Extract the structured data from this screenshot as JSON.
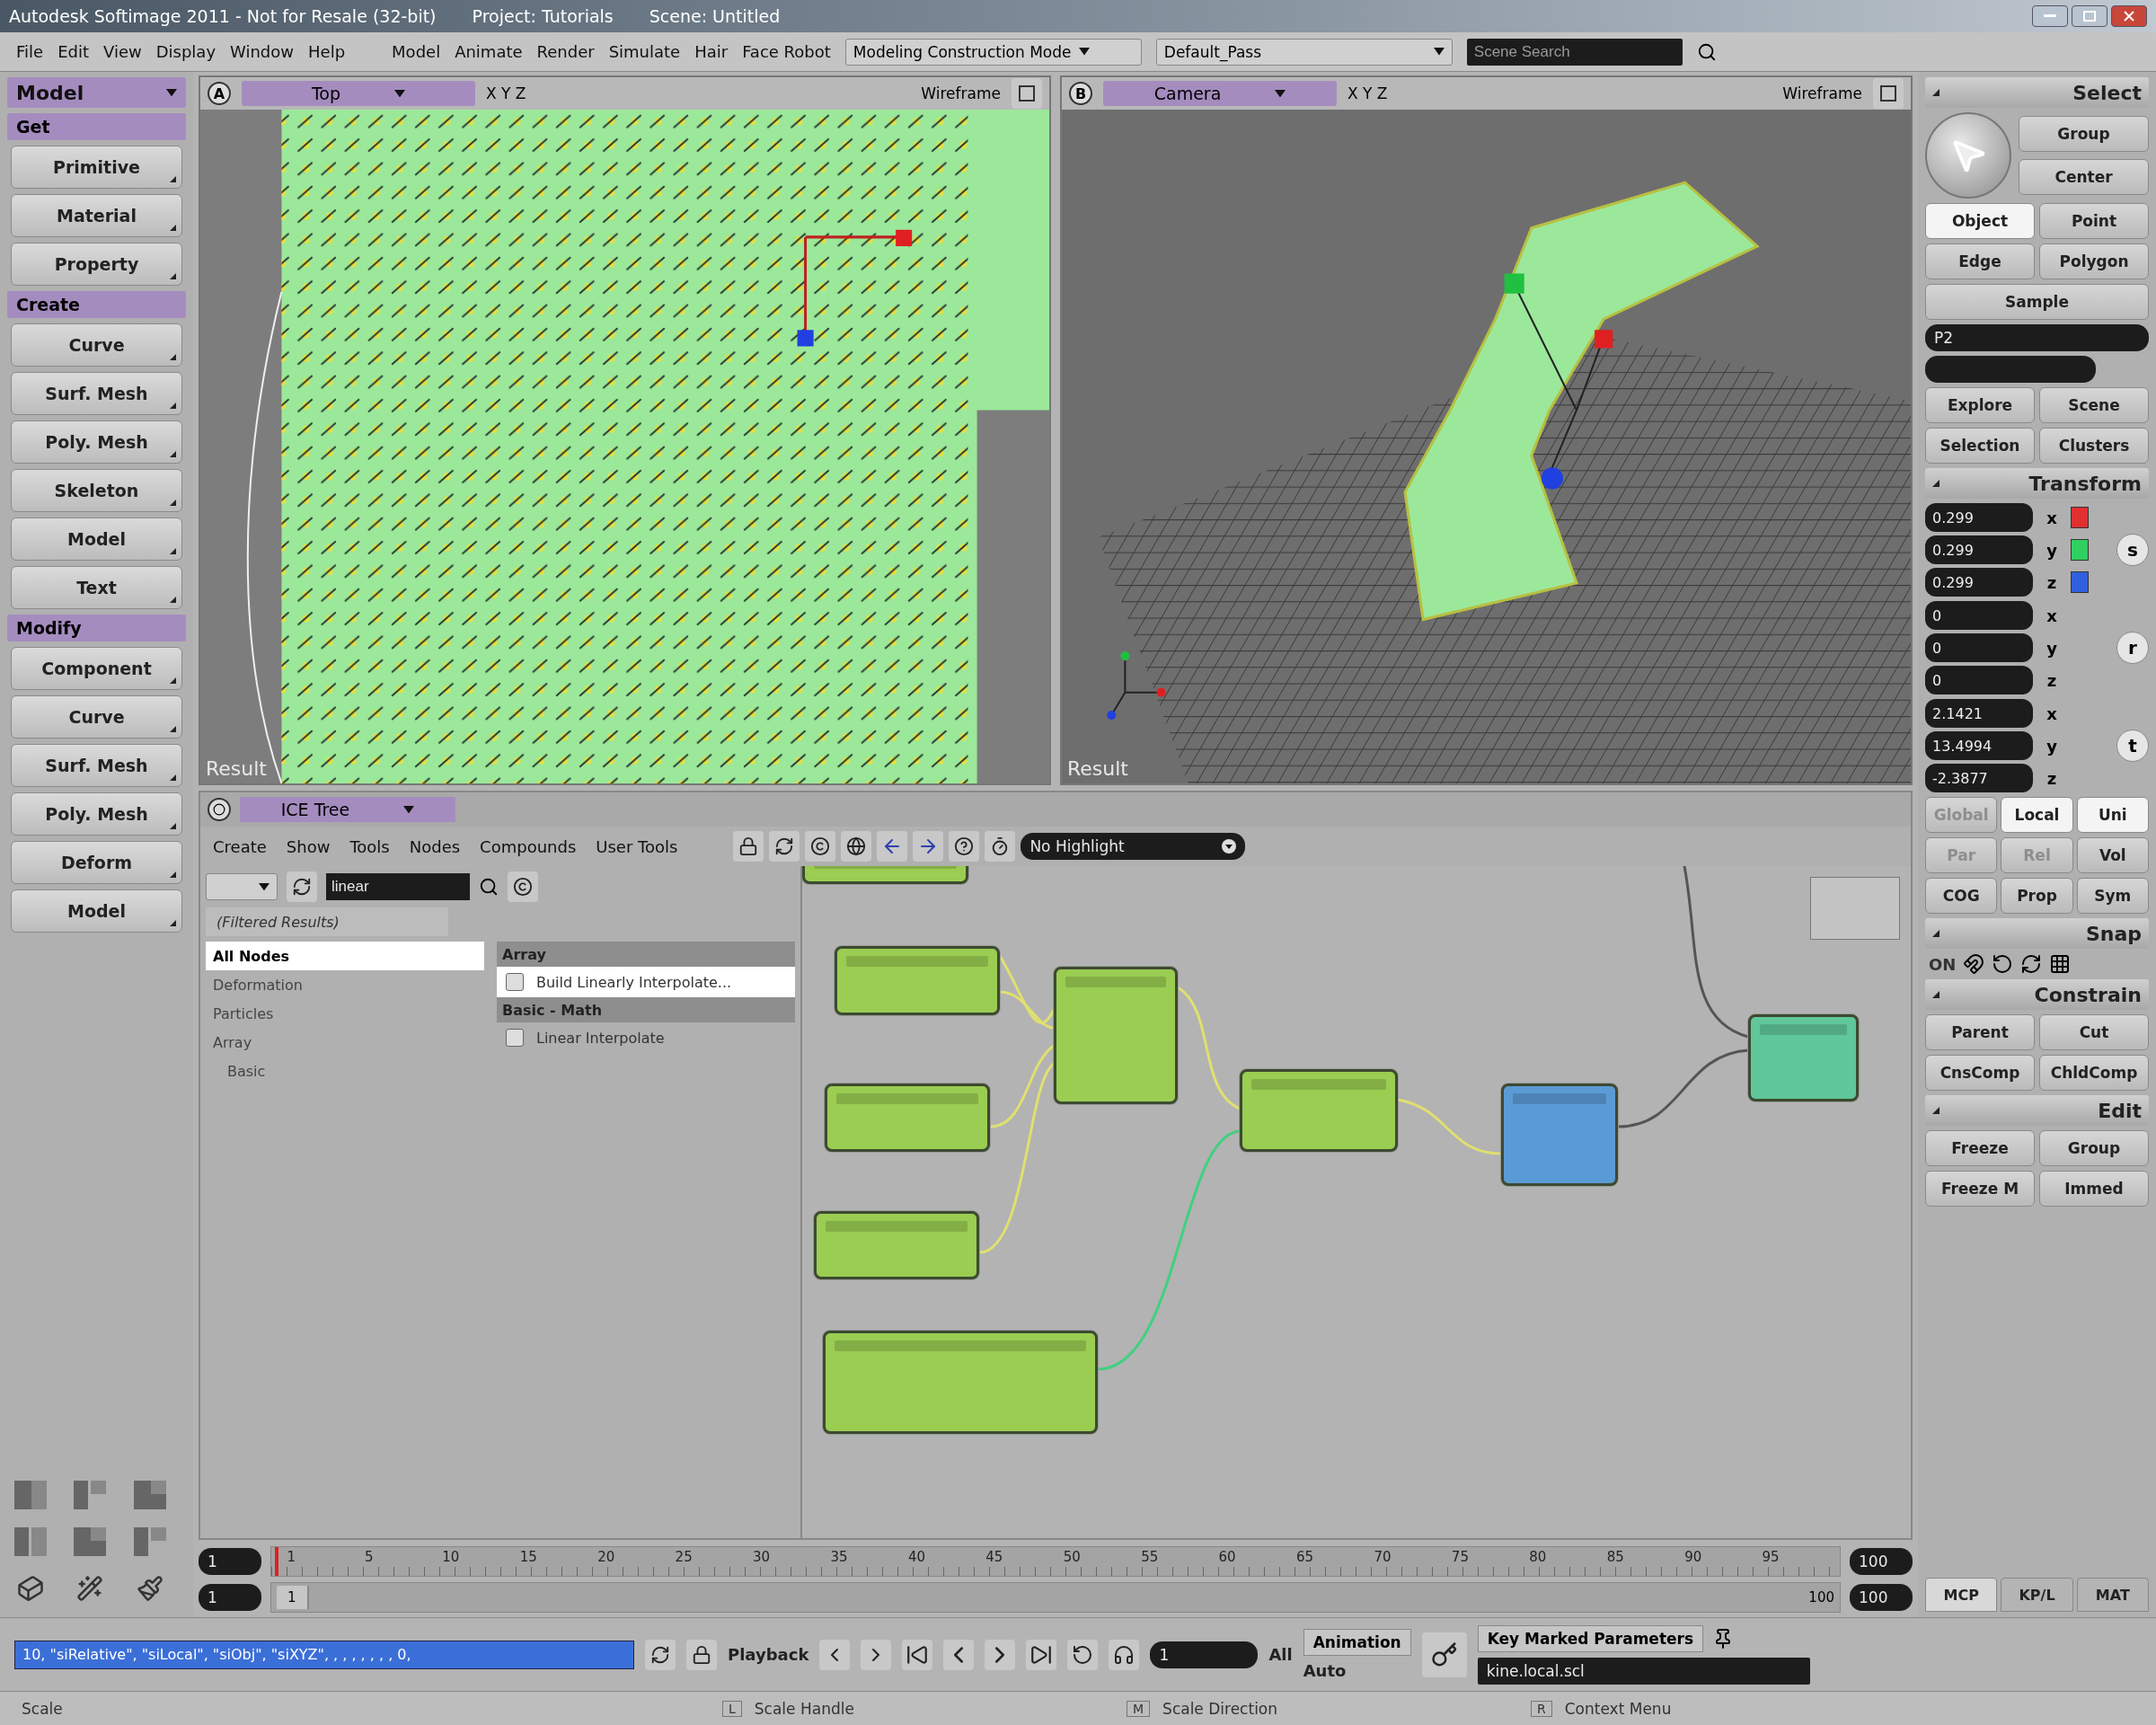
{
  "window": {
    "title": "Autodesk Softimage 2011 - Not for Resale (32-bit)",
    "project": "Project: Tutorials",
    "scene": "Scene: Untitled"
  },
  "menu": {
    "items": [
      "File",
      "Edit",
      "View",
      "Display",
      "Window",
      "Help"
    ],
    "modules": [
      "Model",
      "Animate",
      "Render",
      "Simulate",
      "Hair",
      "Face Robot"
    ],
    "mode": "Modeling Construction Mode",
    "pass": "Default_Pass",
    "search": {
      "placeholder": "Scene Search"
    }
  },
  "toolbar": {
    "module": "Model",
    "sections": [
      {
        "title": "Get",
        "buttons": [
          "Primitive",
          "Material",
          "Property"
        ]
      },
      {
        "title": "Create",
        "buttons": [
          "Curve",
          "Surf. Mesh",
          "Poly. Mesh",
          "Skeleton",
          "Model",
          "Text"
        ]
      },
      {
        "title": "Modify",
        "buttons": [
          "Component",
          "Curve",
          "Surf. Mesh",
          "Poly. Mesh",
          "Deform",
          "Model"
        ]
      }
    ]
  },
  "viewports": [
    {
      "kind": "top",
      "letter": "A",
      "view": "Top",
      "axes": "X Y Z",
      "mode": "Wireframe",
      "caption": "Result"
    },
    {
      "kind": "camera",
      "letter": "B",
      "view": "Camera",
      "axes": "X Y Z",
      "mode": "Wireframe",
      "caption": "Result"
    }
  ],
  "ice_tree": {
    "title": "ICE Tree",
    "menu": [
      "Create",
      "Show",
      "Tools",
      "Nodes",
      "Compounds",
      "User Tools"
    ],
    "highlight": "No Highlight",
    "filter": {
      "value": "linear"
    },
    "results_label": "(Filtered Results)",
    "categories": [
      {
        "label": "All Nodes",
        "selected": true
      },
      {
        "label": "Deformation",
        "selected": false
      },
      {
        "label": "Particles",
        "selected": false
      },
      {
        "label": "Array",
        "selected": false,
        "children": [
          {
            "label": "Basic",
            "selected": false
          }
        ]
      }
    ],
    "groups": [
      {
        "title": "Array",
        "items": [
          {
            "label": "Build Linearly Interpolate...",
            "selected": true
          }
        ]
      },
      {
        "title": "Basic - Math",
        "items": [
          {
            "label": "Linear Interpolate",
            "selected": false
          }
        ]
      }
    ],
    "nodes": [
      {
        "color": "#9acd52"
      },
      {
        "color": "#9acd52"
      },
      {
        "color": "#9acd52"
      },
      {
        "color": "#9acd52"
      },
      {
        "color": "#9acd52"
      },
      {
        "color": "#9acd52"
      },
      {
        "color": "#9acd52"
      },
      {
        "color": "#5b9bd5"
      },
      {
        "color": "#5fc79a"
      }
    ]
  },
  "timeline": {
    "start": "1",
    "end": "100",
    "ticks": [
      "1",
      "5",
      "10",
      "15",
      "20",
      "25",
      "30",
      "35",
      "40",
      "45",
      "50",
      "55",
      "60",
      "65",
      "70",
      "75",
      "80",
      "85",
      "90",
      "95"
    ],
    "range_start": "1",
    "range_start_label": "1",
    "range_end_label": "100",
    "range_end": "100"
  },
  "playback": {
    "command": "10, \"siRelative\", \"siLocal\", \"siObj\", \"siXYZ\", , , , , , , , 0,",
    "label": "Playback",
    "frame": "1",
    "all": "All",
    "animation": "Animation",
    "auto": "Auto",
    "key_label": "Key Marked Parameters",
    "param": "kine.local.scl"
  },
  "select": {
    "title": "Select",
    "top_buttons": [
      "Group",
      "Center"
    ],
    "filters": [
      {
        "label": "Object",
        "selected": true
      },
      {
        "label": "Point",
        "selected": false
      },
      {
        "label": "Edge",
        "selected": false
      },
      {
        "label": "Polygon",
        "selected": false
      }
    ],
    "sample": "Sample",
    "name_field": "P2",
    "buttons": [
      "Explore",
      "Scene",
      "Selection",
      "Clusters"
    ]
  },
  "transform": {
    "title": "Transform",
    "groups": [
      {
        "key": "s",
        "fields": [
          {
            "value": "0.299",
            "axis": "x",
            "color": "#e03030"
          },
          {
            "value": "0.299",
            "axis": "y",
            "color": "#30d060"
          },
          {
            "value": "0.299",
            "axis": "z",
            "color": "#3060e0"
          }
        ]
      },
      {
        "key": "r",
        "fields": [
          {
            "value": "0",
            "axis": "x"
          },
          {
            "value": "0",
            "axis": "y"
          },
          {
            "value": "0",
            "axis": "z"
          }
        ]
      },
      {
        "key": "t",
        "fields": [
          {
            "value": "2.1421",
            "axis": "x"
          },
          {
            "value": "13.4994",
            "axis": "y"
          },
          {
            "value": "-2.3877",
            "axis": "z"
          }
        ]
      }
    ],
    "modes": [
      {
        "label": "Global",
        "selected": false,
        "disabled": true
      },
      {
        "label": "Local",
        "selected": true,
        "disabled": false
      },
      {
        "label": "Uni",
        "selected": true,
        "disabled": false
      }
    ],
    "refs": [
      {
        "label": "Par",
        "selected": false,
        "disabled": true
      },
      {
        "label": "Rel",
        "selected": false,
        "disabled": true
      },
      {
        "label": "Vol",
        "selected": false,
        "disabled": false
      }
    ],
    "extras": [
      "COG",
      "Prop",
      "Sym"
    ]
  },
  "snap": {
    "title": "Snap",
    "on": "ON"
  },
  "constrain": {
    "title": "Constrain",
    "buttons": [
      "Parent",
      "Cut",
      "CnsComp",
      "ChldComp"
    ]
  },
  "edit": {
    "title": "Edit",
    "buttons": [
      "Freeze",
      "Group",
      "Freeze M",
      "Immed"
    ]
  },
  "panel_tabs": [
    {
      "label": "MCP",
      "selected": true
    },
    {
      "label": "KP/L",
      "selected": false
    },
    {
      "label": "MAT",
      "selected": false
    }
  ],
  "status_bar": {
    "hint": "Scale",
    "items": [
      {
        "key": "L",
        "label": "Scale Handle"
      },
      {
        "key": "M",
        "label": "Scale Direction"
      },
      {
        "key": "R",
        "label": "Context Menu"
      }
    ]
  }
}
